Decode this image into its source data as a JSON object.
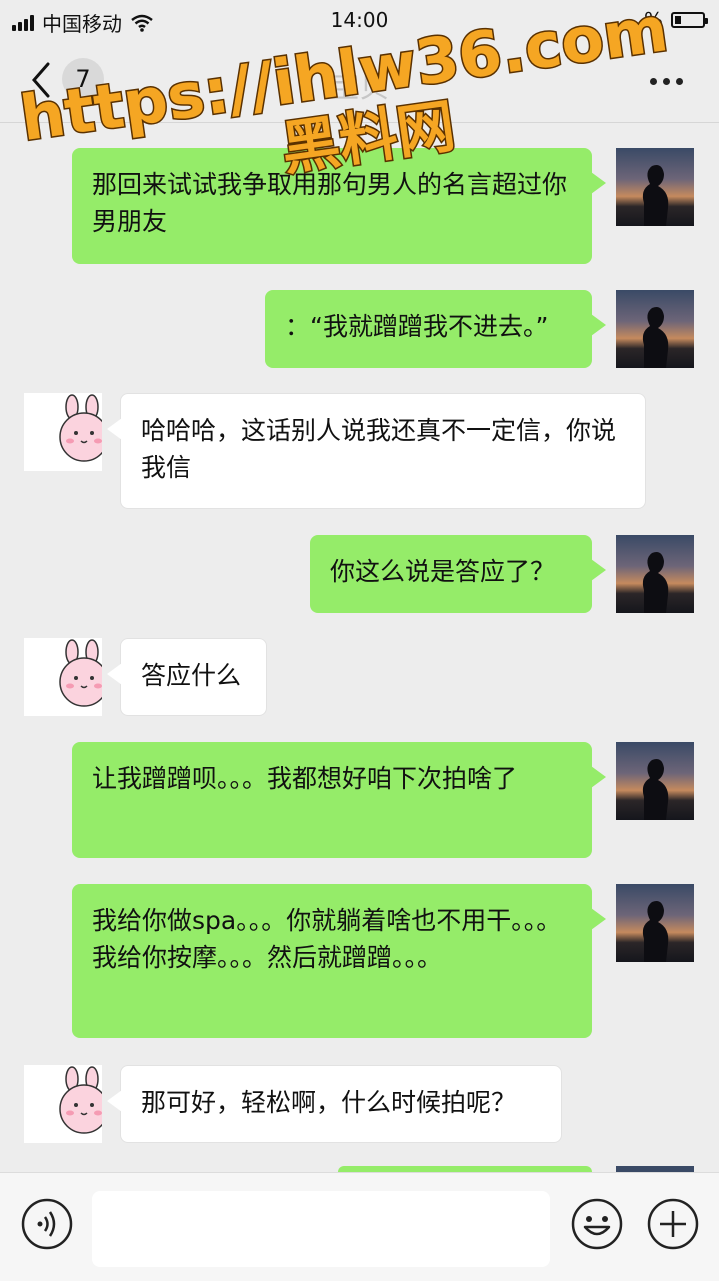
{
  "status_bar": {
    "carrier": "中国移动",
    "time": "14:00",
    "battery_percent": "%"
  },
  "nav": {
    "unread_count": "7",
    "title": "宝贝"
  },
  "messages": [
    {
      "sender": "me",
      "text": "那回来试试我争取用那句男人的名言超过你男朋友"
    },
    {
      "sender": "me",
      "text": "：“我就蹭蹭我不进去。”"
    },
    {
      "sender": "them",
      "text": "哈哈哈，这话别人说我还真不一定信，你说我信"
    },
    {
      "sender": "me",
      "text": "你这么说是答应了？"
    },
    {
      "sender": "them",
      "text": "答应什么"
    },
    {
      "sender": "me",
      "text": "让我蹭蹭呗。。。我都想好咱下次拍啥了"
    },
    {
      "sender": "me",
      "text": "我给你做spa。。。你就躺着啥也不用干。。。我给你按摩。。。然后就蹭蹭。。。"
    },
    {
      "sender": "them",
      "text": "那可好，轻松啊，什么时候拍呢？"
    }
  ],
  "input_bar": {
    "placeholder": ""
  },
  "watermark": {
    "line1": "https://ihlw36.com",
    "line2": "黑料网"
  },
  "colors": {
    "me_bubble": "#95ec69",
    "them_bubble": "#ffffff",
    "background": "#ededed",
    "watermark_fill": "#f5a623"
  }
}
